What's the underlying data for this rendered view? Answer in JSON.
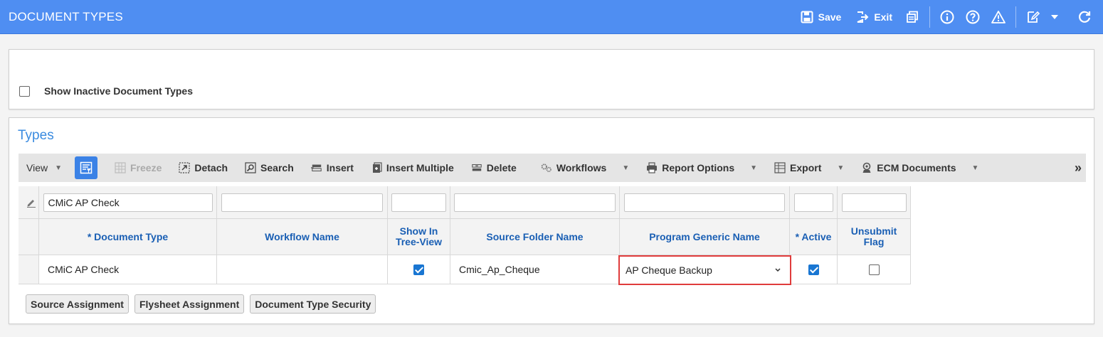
{
  "header": {
    "title": "DOCUMENT TYPES",
    "save_label": "Save",
    "exit_label": "Exit",
    "icons": [
      "save-icon",
      "exit-icon",
      "copy-icon",
      "info-icon",
      "help-icon",
      "warning-icon",
      "edit-icon",
      "chevron-down-icon",
      "refresh-icon"
    ]
  },
  "filter": {
    "show_inactive_label": "Show Inactive Document Types",
    "show_inactive_checked": false
  },
  "types": {
    "title": "Types",
    "toolbar": {
      "view": "View",
      "freeze": "Freeze",
      "detach": "Detach",
      "search": "Search",
      "insert": "Insert",
      "insert_multiple": "Insert Multiple",
      "delete": "Delete",
      "workflows": "Workflows",
      "report_options": "Report Options",
      "export": "Export",
      "ecm_documents": "ECM Documents",
      "more": "»"
    },
    "filters": {
      "document_type": "CMiC AP Check",
      "workflow_name": "",
      "show_in_tree": "",
      "source_folder": "",
      "program_generic": "",
      "active": "",
      "unsubmit": ""
    },
    "columns": {
      "document_type": "* Document Type",
      "workflow_name": "Workflow Name",
      "show_in_tree_1": "Show In",
      "show_in_tree_2": "Tree-View",
      "source_folder": "Source Folder Name",
      "program_generic": "Program Generic Name",
      "active": "* Active",
      "unsubmit_1": "Unsubmit",
      "unsubmit_2": "Flag"
    },
    "rows": [
      {
        "document_type": "CMiC AP Check",
        "workflow_name": "",
        "show_in_tree": true,
        "source_folder": "Cmic_Ap_Cheque",
        "program_generic": "AP Cheque Backup",
        "active": true,
        "unsubmit": false
      }
    ],
    "buttons": {
      "source_assignment": "Source Assignment",
      "flysheet_assignment": "Flysheet Assignment",
      "document_type_security": "Document Type Security"
    }
  },
  "colors": {
    "header_bg": "#4f8ef2",
    "section_title": "#3a8be0",
    "column_header": "#1a5fb4",
    "checkbox_checked": "#1976d2",
    "highlight_border": "#e03c3c"
  }
}
